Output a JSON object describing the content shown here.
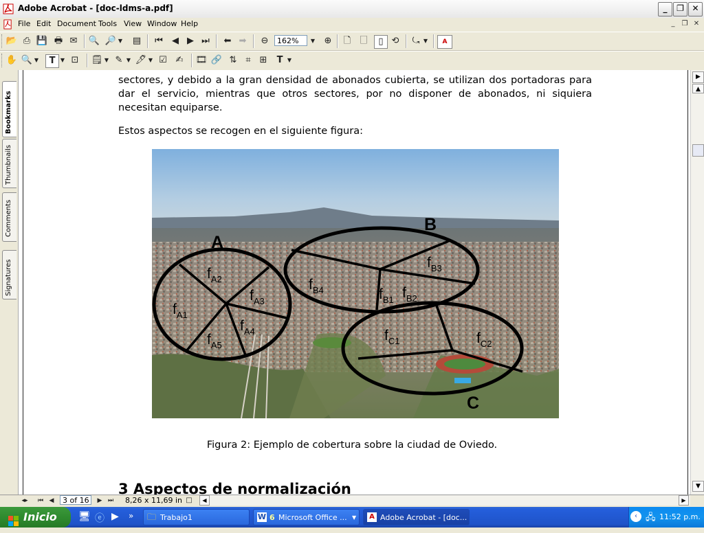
{
  "window": {
    "title": "Adobe Acrobat - [doc-ldms-a.pdf]"
  },
  "menu": [
    "File",
    "Edit",
    "Document",
    "Tools",
    "View",
    "Window",
    "Help"
  ],
  "toolbar": {
    "zoom": "162%"
  },
  "nav_tabs": [
    "Bookmarks",
    "Thumbnails",
    "Comments",
    "Signatures"
  ],
  "document": {
    "para1": "sectores, y debido a la gran densidad de abonados cubierta, se utilizan dos portadoras para dar el servicio, mientras que otros sectores, por no disponer de abonados, ni siquiera necesitan equiparse.",
    "para2": "Estos aspectos se recogen en el siguiente figura:",
    "figure_labels": {
      "A": "A",
      "B": "B",
      "C": "C",
      "A1": "A1",
      "A2": "A2",
      "A3": "A3",
      "A4": "A4",
      "A5": "A5",
      "B1": "B1",
      "B2": "B2",
      "B3": "B3",
      "B4": "B4",
      "C1": "C1",
      "C2": "C2",
      "f": "f"
    },
    "caption": "Figura 2: Ejemplo de cobertura sobre la ciudad de Oviedo.",
    "heading": "3  Aspectos de normalización"
  },
  "status": {
    "page": "3 of 16",
    "page_size": "8,26 x 11,69 in"
  },
  "taskbar": {
    "start": "Inicio",
    "tasks": [
      "Trabajo1",
      "Microsoft Office ...",
      "Adobe Acrobat - [doc..."
    ],
    "office_count": "6",
    "clock": "11:52 p.m."
  }
}
